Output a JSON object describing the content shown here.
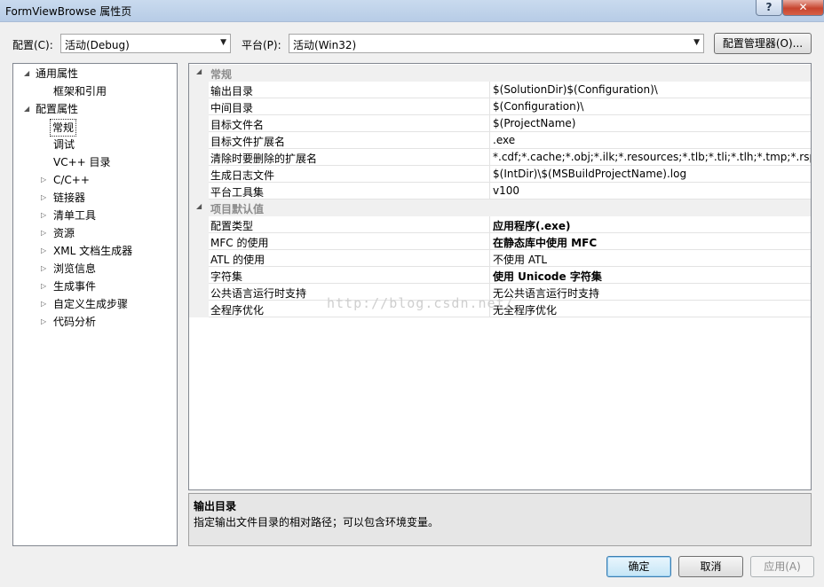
{
  "window": {
    "title": "FormViewBrowse 属性页",
    "help_glyph": "?",
    "close_glyph": "✕"
  },
  "config": {
    "label": "配置(C):",
    "value": "活动(Debug)"
  },
  "platform": {
    "label": "平台(P):",
    "value": "活动(Win32)"
  },
  "config_manager_label": "配置管理器(O)...",
  "tree": {
    "items": [
      {
        "label": "通用属性",
        "expander": "◢"
      },
      {
        "label": "框架和引用",
        "expander": ""
      },
      {
        "label": "配置属性",
        "expander": "◢"
      },
      {
        "label": "常规",
        "expander": ""
      },
      {
        "label": "调试",
        "expander": ""
      },
      {
        "label": "VC++ 目录",
        "expander": ""
      },
      {
        "label": "C/C++",
        "expander": "▷"
      },
      {
        "label": "链接器",
        "expander": "▷"
      },
      {
        "label": "清单工具",
        "expander": "▷"
      },
      {
        "label": "资源",
        "expander": "▷"
      },
      {
        "label": "XML 文档生成器",
        "expander": "▷"
      },
      {
        "label": "浏览信息",
        "expander": "▷"
      },
      {
        "label": "生成事件",
        "expander": "▷"
      },
      {
        "label": "自定义生成步骤",
        "expander": "▷"
      },
      {
        "label": "代码分析",
        "expander": "▷"
      }
    ]
  },
  "grid": {
    "categories": [
      {
        "label": "常规",
        "expander": "◢"
      },
      {
        "label": "项目默认值",
        "expander": "◢"
      }
    ],
    "rows": [
      {
        "name": "输出目录",
        "value": "$(SolutionDir)$(Configuration)\\"
      },
      {
        "name": "中间目录",
        "value": "$(Configuration)\\"
      },
      {
        "name": "目标文件名",
        "value": "$(ProjectName)"
      },
      {
        "name": "目标文件扩展名",
        "value": ".exe"
      },
      {
        "name": "清除时要删除的扩展名",
        "value": "*.cdf;*.cache;*.obj;*.ilk;*.resources;*.tlb;*.tli;*.tlh;*.tmp;*.rsp;*.pgc"
      },
      {
        "name": "生成日志文件",
        "value": "$(IntDir)\\$(MSBuildProjectName).log"
      },
      {
        "name": "平台工具集",
        "value": "v100"
      },
      {
        "name": "配置类型",
        "value": "应用程序(.exe)"
      },
      {
        "name": "MFC 的使用",
        "value": "在静态库中使用 MFC"
      },
      {
        "name": "ATL 的使用",
        "value": "不使用 ATL"
      },
      {
        "name": "字符集",
        "value": "使用 Unicode 字符集"
      },
      {
        "name": "公共语言运行时支持",
        "value": "无公共语言运行时支持"
      },
      {
        "name": "全程序优化",
        "value": "无全程序优化"
      }
    ]
  },
  "description": {
    "title": "输出目录",
    "text": "指定输出文件目录的相对路径；可以包含环境变量。"
  },
  "watermark": "http://blog.csdn.net/",
  "buttons": {
    "ok": "确定",
    "cancel": "取消",
    "apply": "应用(A)"
  },
  "combo_arrow": "▼"
}
